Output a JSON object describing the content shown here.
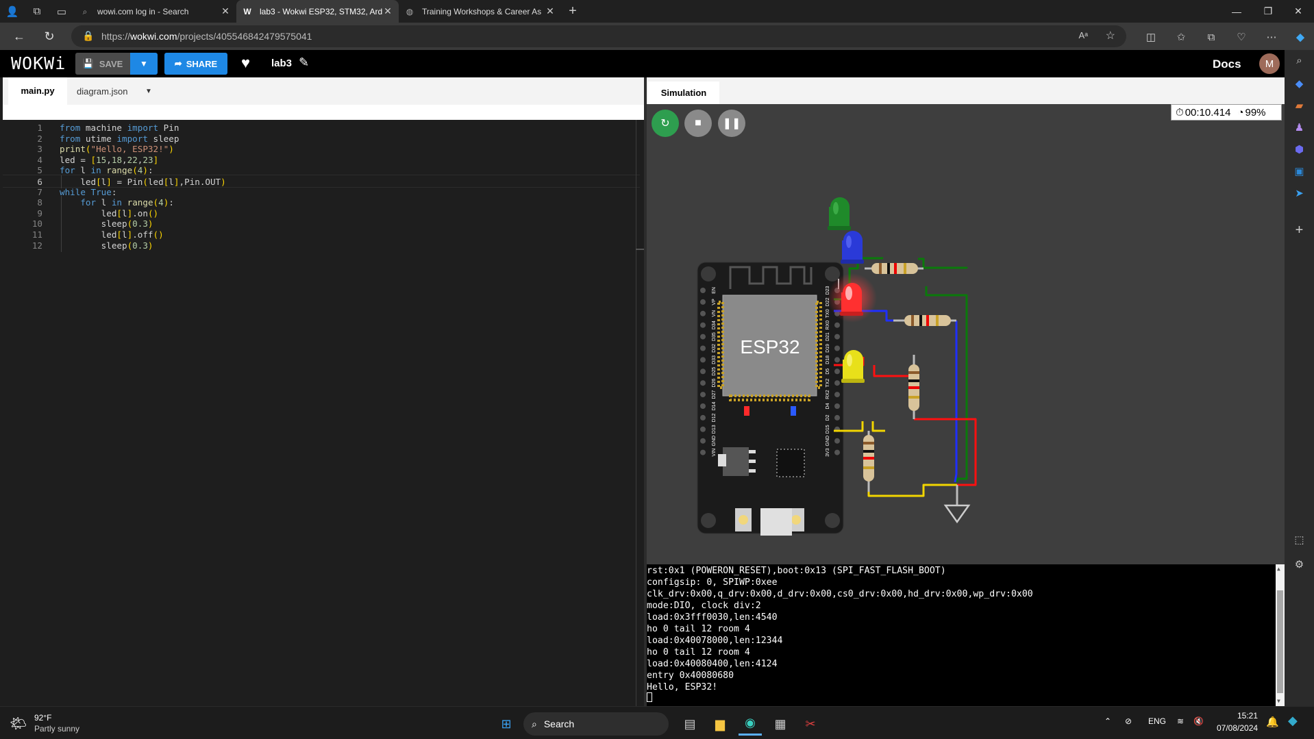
{
  "browser": {
    "tabs": [
      {
        "title": "wowi.com log in - Search",
        "icon": "search-icon",
        "active": false
      },
      {
        "title": "lab3 - Wokwi ESP32, STM32, Ard",
        "icon": "wokwi-favicon",
        "active": true
      },
      {
        "title": "Training Workshops & Career As",
        "icon": "site-favicon",
        "active": false
      }
    ],
    "url_prefix": "https://",
    "url_domain": "wokwi.com",
    "url_path": "/projects/405546842479575041"
  },
  "wokwi": {
    "logo": "WOKWi",
    "save_label": "SAVE",
    "share_label": "SHARE",
    "project_name": "lab3",
    "docs_label": "Docs",
    "avatar_initial": "M"
  },
  "editor": {
    "tabs": [
      "main.py",
      "diagram.json"
    ],
    "active_tab": "main.py",
    "lines": [
      "from machine import Pin",
      "from utime import sleep",
      "print(\"Hello, ESP32!\")",
      "led = [15,18,22,23]",
      "for l in range(4):",
      "    led[l] = Pin(led[l],Pin.OUT)",
      "while True:",
      "    for l in range(4):",
      "        led[l].on()",
      "        sleep(0.3)",
      "        led[l].off()",
      "        sleep(0.3)"
    ],
    "line_numbers": [
      "1",
      "2",
      "3",
      "4",
      "5",
      "6",
      "7",
      "8",
      "9",
      "10",
      "11",
      "12"
    ],
    "current_line": 6
  },
  "simulation": {
    "tab_label": "Simulation",
    "timer": "00:10.414",
    "speed": "99%",
    "board_label": "ESP32",
    "left_pins": [
      "EN",
      "VP",
      "VN",
      "D34",
      "D35",
      "D32",
      "D33",
      "D25",
      "D26",
      "D27",
      "D14",
      "D12",
      "D13",
      "GND",
      "VIN"
    ],
    "right_pins": [
      "D23",
      "D22",
      "TX0",
      "RX0",
      "D21",
      "D19",
      "D18",
      "D5",
      "TX2",
      "RX2",
      "D4",
      "D2",
      "D15",
      "GND",
      "3V3"
    ],
    "leds": [
      {
        "color": "green",
        "lit": false
      },
      {
        "color": "blue",
        "lit": false
      },
      {
        "color": "red",
        "lit": true
      },
      {
        "color": "yellow",
        "lit": false
      }
    ]
  },
  "serial": {
    "lines": [
      "rst:0x1 (POWERON_RESET),boot:0x13 (SPI_FAST_FLASH_BOOT)",
      "configsip: 0, SPIWP:0xee",
      "clk_drv:0x00,q_drv:0x00,d_drv:0x00,cs0_drv:0x00,hd_drv:0x00,wp_drv:0x00",
      "mode:DIO, clock div:2",
      "load:0x3fff0030,len:4540",
      "ho 0 tail 12 room 4",
      "load:0x40078000,len:12344",
      "ho 0 tail 12 room 4",
      "load:0x40080400,len:4124",
      "entry 0x40080680",
      "Hello, ESP32!"
    ]
  },
  "taskbar": {
    "weather_temp": "92°F",
    "weather_desc": "Partly sunny",
    "search_label": "Search",
    "language": "ENG",
    "time": "15:21",
    "date": "07/08/2024"
  }
}
